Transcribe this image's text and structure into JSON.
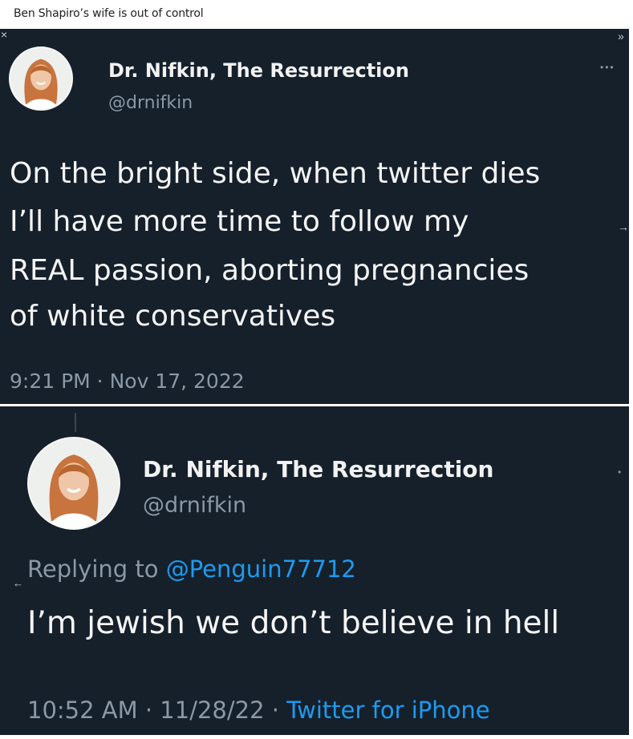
{
  "post": {
    "title": "Ben Shapiro’s wife is out of control"
  },
  "tweet1": {
    "name": "Dr. Nifkin, The Resurrection",
    "handle": "@drnifkin",
    "more": "•••",
    "lines": [
      "On the bright side, when twitter dies",
      "I’ll have more time to follow my",
      "REAL passion, aborting pregnancies",
      "of white conservatives"
    ],
    "time": "9:21 PM · Nov 17, 2022"
  },
  "tweet2": {
    "name": "Dr. Nifkin, The Resurrection",
    "handle": "@drnifkin",
    "more": "•",
    "replying_prefix": "Replying to ",
    "replying_handle": "@Penguin77712",
    "text": "I’m jewish we don’t believe in hell",
    "time": "10:52 AM · 11/28/22 · ",
    "source": "Twitter for iPhone"
  },
  "glyphs": {
    "top_left": "×",
    "top_right": "»",
    "right_arrow": "→",
    "left_arrow": "←"
  },
  "colors": {
    "background": "#15202b",
    "link": "#1d9bf0",
    "muted": "#8b98a5"
  },
  "icons": [
    "avatar-photo",
    "more-options-icon",
    "arrow-icon"
  ]
}
